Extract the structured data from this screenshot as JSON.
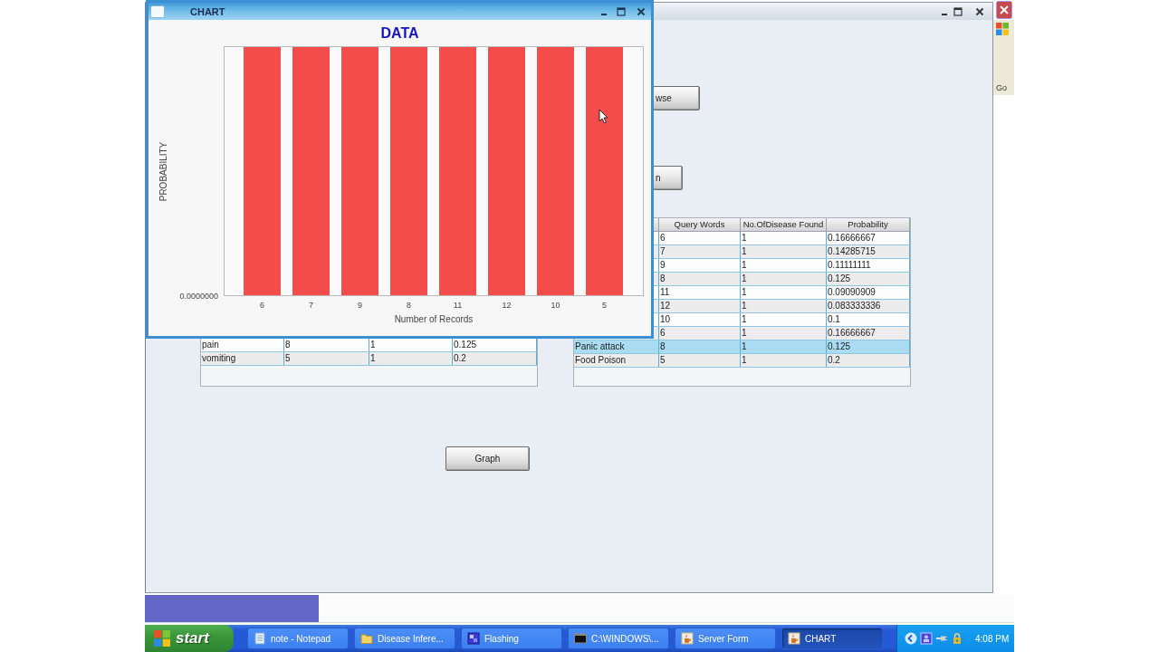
{
  "main_window": {
    "active": false,
    "buttons": [
      {
        "label": "wse"
      },
      {
        "label": "n"
      }
    ],
    "left_table": {
      "rows": [
        {
          "cells": [
            "pain",
            "8",
            "1",
            "0.125"
          ],
          "selected": false
        },
        {
          "cells": [
            "vomiting",
            "5",
            "1",
            "0.2"
          ],
          "selected": false
        }
      ]
    },
    "right_table": {
      "columns": [
        "Query Words",
        "No.OfDisease Found",
        "Probability"
      ],
      "rows": [
        {
          "cells": [
            "6",
            "1",
            "0.16666667"
          ],
          "selected": false
        },
        {
          "cells": [
            "7",
            "1",
            "0.14285715"
          ],
          "selected": false
        },
        {
          "cells": [
            "9",
            "1",
            "0.11111111"
          ],
          "selected": false
        },
        {
          "cells": [
            "8",
            "1",
            "0.125"
          ],
          "selected": false
        },
        {
          "cells": [
            "11",
            "1",
            "0.09090909"
          ],
          "selected": false
        },
        {
          "cells": [
            "12",
            "1",
            "0.083333336"
          ],
          "selected": false
        },
        {
          "cells": [
            "10",
            "1",
            "0.1"
          ],
          "selected": false
        },
        {
          "cells": [
            "6",
            "1",
            "0.16666667"
          ],
          "selected": false
        },
        {
          "column_1": "Panic attack",
          "cells": [
            "8",
            "1",
            "0.125"
          ],
          "selected": true
        },
        {
          "column_1": "Food Poison",
          "cells": [
            "5",
            "1",
            "0.2"
          ],
          "selected": false
        }
      ]
    },
    "graph_button": "Graph"
  },
  "chart_window": {
    "title": "CHART",
    "active": true,
    "chart": {
      "title": "DATA",
      "ylabel": "PROBABILITY",
      "y_tick": "0.0000000",
      "categories": [
        "6",
        "7",
        "9",
        "8",
        "11",
        "12",
        "10",
        "5"
      ],
      "xlabel": "Number of Records"
    }
  },
  "background_window": {
    "toolbar_button": "Go"
  },
  "progress": {
    "level": 0.2
  },
  "taskbar": {
    "start": "start",
    "tasks": [
      {
        "label": "note - Notepad",
        "kind": "notepad",
        "selected": false
      },
      {
        "label": "Disease Infere...",
        "kind": "folder",
        "selected": false
      },
      {
        "label": "Flashing",
        "kind": "app",
        "selected": false
      },
      {
        "label": "C:\\WINDOWS\\...",
        "kind": "console",
        "selected": false
      },
      {
        "label": "Server Form",
        "kind": "java",
        "selected": false
      },
      {
        "label": "CHART",
        "kind": "java",
        "selected": true
      }
    ],
    "clock": "4:08 PM"
  }
}
